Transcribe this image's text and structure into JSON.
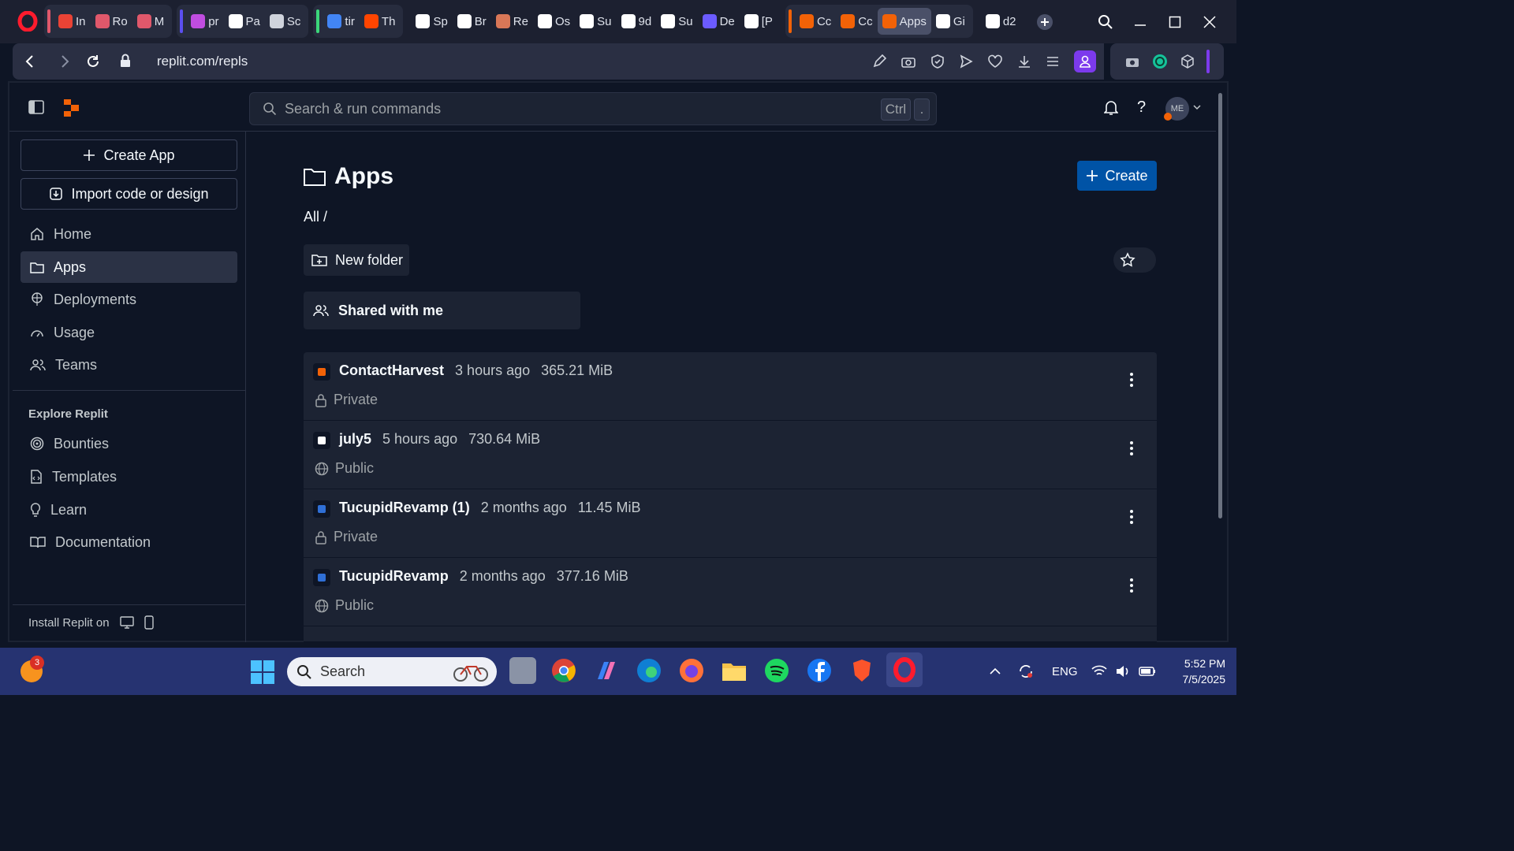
{
  "browser": {
    "tabs": [
      {
        "label": "In",
        "icon": "gmail-icon",
        "color": "#ea4335"
      },
      {
        "label": "Ro",
        "icon": "heart-outline-icon",
        "color": "#e0586b"
      },
      {
        "label": "M",
        "icon": "heart-outline-icon",
        "color": "#e0586b"
      },
      {
        "label": "pr",
        "icon": "gradient-app-icon",
        "color": "#c04de0"
      },
      {
        "label": "Pa",
        "icon": "heart-icon",
        "color": "#ffffff"
      },
      {
        "label": "Sc",
        "icon": "camera-icon",
        "color": "#cfd3dc"
      },
      {
        "label": "tir",
        "icon": "google-icon",
        "color": "#4285f4"
      },
      {
        "label": "Th",
        "icon": "reddit-icon",
        "color": "#ff4500"
      },
      {
        "label": "Sp",
        "icon": "grid-icon",
        "color": "#ffffff"
      },
      {
        "label": "Br",
        "icon": "globe-icon",
        "color": "#ffffff"
      },
      {
        "label": "Re",
        "icon": "sparkle-icon",
        "color": "#d97757"
      },
      {
        "label": "Os",
        "icon": "globe-icon",
        "color": "#ffffff"
      },
      {
        "label": "Su",
        "icon": "globe-icon",
        "color": "#ffffff"
      },
      {
        "label": "9d",
        "icon": "globe-icon",
        "color": "#ffffff"
      },
      {
        "label": "Su",
        "icon": "globe-icon",
        "color": "#ffffff"
      },
      {
        "label": "De",
        "icon": "s-app-icon",
        "color": "#6b5bff"
      },
      {
        "label": "[P",
        "icon": "github-icon",
        "color": "#ffffff"
      },
      {
        "label": "Cc",
        "icon": "replit-icon",
        "color": "#f26207"
      },
      {
        "label": "Cc",
        "icon": "replit-icon",
        "color": "#f26207"
      },
      {
        "label": "Apps",
        "icon": "replit-icon",
        "color": "#f26207",
        "active": true
      },
      {
        "label": "Gi",
        "icon": "github-icon",
        "color": "#ffffff"
      },
      {
        "label": "d2",
        "icon": "globe-icon",
        "color": "#ffffff"
      }
    ],
    "url": "replit.com/repls"
  },
  "replit": {
    "search_placeholder": "Search & run commands",
    "shortcut_key1": "Ctrl",
    "shortcut_key2": ".",
    "avatar_initials": "ME",
    "sidebar": {
      "create_app": "Create App",
      "import": "Import code or design",
      "nav": [
        "Home",
        "Apps",
        "Deployments",
        "Usage",
        "Teams"
      ],
      "explore_title": "Explore Replit",
      "explore": [
        "Bounties",
        "Templates",
        "Learn",
        "Documentation"
      ],
      "install": "Install Replit on"
    },
    "main": {
      "title": "Apps",
      "breadcrumb": "All /",
      "create_button": "Create",
      "new_folder": "New folder",
      "shared": "Shared with me",
      "repls": [
        {
          "name": "ContactHarvest",
          "updated": "3 hours ago",
          "size": "365.21 MiB",
          "visibility": "Private",
          "icon": "cart-icon"
        },
        {
          "name": "july5",
          "updated": "5 hours ago",
          "size": "730.64 MiB",
          "visibility": "Public",
          "icon": "cube-icon"
        },
        {
          "name": "TucupidRevamp (1)",
          "updated": "2 months ago",
          "size": "11.45 MiB",
          "visibility": "Private",
          "icon": "wrench-icon"
        },
        {
          "name": "TucupidRevamp",
          "updated": "2 months ago",
          "size": "377.16 MiB",
          "visibility": "Public",
          "icon": "wrench-icon"
        }
      ]
    }
  },
  "taskbar": {
    "search_label": "Search",
    "notification_count": "3",
    "language": "ENG",
    "time": "5:52 PM",
    "date": "7/5/2025"
  }
}
